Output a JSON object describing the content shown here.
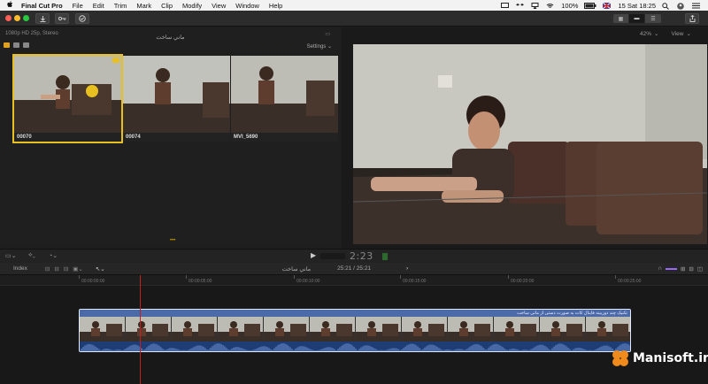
{
  "menubar": {
    "apple": "",
    "items": [
      "Final Cut Pro",
      "File",
      "Edit",
      "Trim",
      "Mark",
      "Clip",
      "Modify",
      "View",
      "Window",
      "Help"
    ],
    "battery": "100%",
    "clock": "15 Sat 18:25"
  },
  "toolbar": {
    "import_icon": "download-icon",
    "keyword_icon": "key-icon",
    "bg_tasks_icon": "checkmark-icon",
    "share_icon": "share-icon"
  },
  "browser": {
    "format": "1080p HD 25p, Stereo",
    "library_title": "ماني ساخت",
    "settings_label": "Settings",
    "clips": [
      "00070",
      "00074",
      "MVI_5690"
    ]
  },
  "viewer": {
    "zoom": "42%",
    "view_label": "View"
  },
  "midbar": {
    "timecode": "2:23"
  },
  "timeline": {
    "index_label": "Index",
    "project_name": "ماني ساخت",
    "duration": "25:21 / 25:21",
    "ruler": [
      "00:00:00:00",
      "00:00:05:00",
      "00:00:10:00",
      "00:00:15:00",
      "00:00:20:00",
      "00:00:25:00"
    ],
    "clip_title": "تکنیک چند دوربینه فاینال کات به صورت دستی از مانی ساخت"
  },
  "watermark": {
    "text": "Manisoft.ir"
  },
  "colors": {
    "selection": "#e8c020",
    "clip_blue": "#2f4a7a",
    "playhead": "#c02020"
  }
}
